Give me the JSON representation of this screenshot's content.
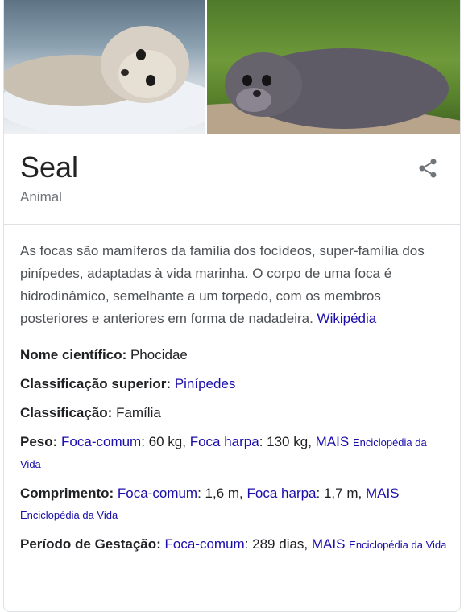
{
  "entity": {
    "title": "Seal",
    "subtitle": "Animal"
  },
  "description": {
    "text": "As focas são mamíferos da família dos focídeos, super-família dos pinípedes, adaptadas à vida marinha. O corpo de uma foca é hidrodinâmico, semelhante a um torpedo, com os membros posteriores e anteriores em forma de nadadeira. ",
    "source_link": "Wikipédia"
  },
  "facts": {
    "nome_cientifico": {
      "label": "Nome científico:",
      "value": " Phocidae"
    },
    "classificacao_superior": {
      "label": "Classificação superior:",
      "link": "Pinípedes"
    },
    "classificacao": {
      "label": "Classificação:",
      "value": " Família"
    },
    "peso": {
      "label": "Peso:",
      "link1": "Foca-comum",
      "value1": ": 60 kg, ",
      "link2": "Foca harpa",
      "value2": ": 130 kg, ",
      "more": "MAIS",
      "source": "Enciclopédia da Vida"
    },
    "comprimento": {
      "label": "Comprimento:",
      "link1": "Foca-comum",
      "value1": ": 1,6 m, ",
      "link2": "Foca harpa",
      "value2": ": 1,7 m, ",
      "more": "MAIS",
      "source": "Enciclopédia da Vida"
    },
    "gestacao": {
      "label": "Período de Gestação:",
      "link1": "Foca-comum",
      "value1": ": 289 dias, ",
      "more": "MAIS",
      "source": "Enciclopédia da Vida"
    }
  }
}
